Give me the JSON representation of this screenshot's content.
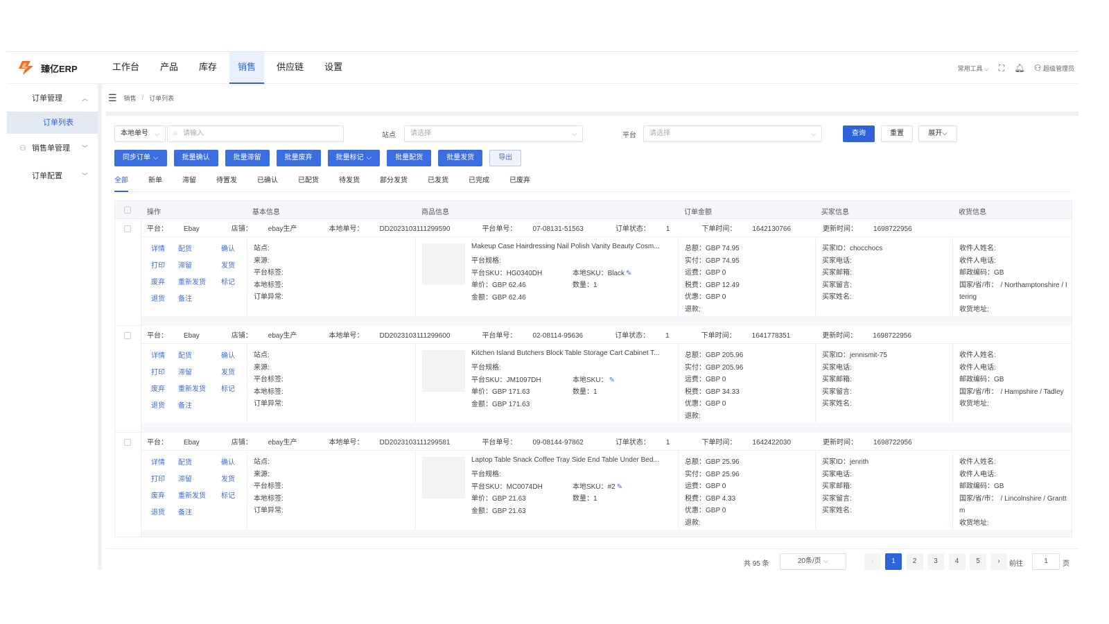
{
  "app": {
    "name": "臻亿ERP",
    "brand_color": "#f36c21",
    "accent": "#2f63d8"
  },
  "nav": [
    {
      "label": "工作台"
    },
    {
      "label": "产品"
    },
    {
      "label": "库存"
    },
    {
      "label": "销售",
      "active": true
    },
    {
      "label": "供应链"
    },
    {
      "label": "设置"
    }
  ],
  "header": {
    "tools": "常用工具",
    "user": "超级管理员"
  },
  "sidebar": {
    "groups": [
      {
        "label": "订单管理",
        "expanded": true,
        "children": [
          {
            "label": "订单列表",
            "active": true
          }
        ]
      },
      {
        "label": "销售单管理",
        "icon": "user-icon",
        "expanded": false
      },
      {
        "label": "订单配置",
        "expanded": false
      }
    ]
  },
  "breadcrumb": [
    "销售",
    "订单列表"
  ],
  "filter": {
    "type_select": "本地单号",
    "search_placeholder": "请输入",
    "site_label": "站点",
    "site_placeholder": "请选择",
    "platform_label": "平台",
    "platform_placeholder": "请选择",
    "query": "查询",
    "reset": "重置",
    "expand": "展开"
  },
  "toolbar": [
    {
      "label": "同步订单",
      "dropdown": true
    },
    {
      "label": "批量确认"
    },
    {
      "label": "批量滞留"
    },
    {
      "label": "批量废弃"
    },
    {
      "label": "批量标记",
      "dropdown": true
    },
    {
      "label": "批量配货"
    },
    {
      "label": "批量发货"
    },
    {
      "label": "导出",
      "plain": true
    }
  ],
  "tabs": [
    "全部",
    "新单",
    "滞留",
    "待置发",
    "已确认",
    "已配货",
    "待发货",
    "部分发货",
    "已发货",
    "已完成",
    "已废弃"
  ],
  "columns": [
    "操作",
    "基本信息",
    "商品信息",
    "订单金额",
    "买家信息",
    "收货信息"
  ],
  "actions": [
    "详情",
    "配货",
    "确认",
    "打印",
    "滞留",
    "发货",
    "废弃",
    "重新发货",
    "标记",
    "退货",
    "备注"
  ],
  "labels": {
    "platform": "平台：",
    "shop": "店铺：",
    "local_no": "本地单号：",
    "platform_no": "平台单号：",
    "status": "订单状态：",
    "order_time": "下单时间：",
    "update_time": "更新时间：",
    "basic": [
      "站点:",
      "来源:",
      "平台标签:",
      "本地标签:",
      "订单异常:"
    ],
    "spec": "平台规格:",
    "psku": "平台SKU：",
    "lsku": "本地SKU：",
    "unit_price": "单价：",
    "qty": "数量：",
    "amount": "金额：",
    "total": "总额：",
    "paid": "实付：",
    "shipping": "运费：",
    "tax": "税费：",
    "discount": "优惠：",
    "refund": "退款:",
    "buyer_id": "买家ID：",
    "buyer_phone": "买家电话:",
    "buyer_email": "买家邮箱:",
    "buyer_msg": "买家留言:",
    "buyer_name": "买家姓名:",
    "recv_name": "收件人姓名:",
    "recv_phone": "收件人电话:",
    "postcode": "邮政编码：",
    "region": "国家/省/市：",
    "address": "收货地址:"
  },
  "orders": [
    {
      "platform": "Ebay",
      "shop": "ebay生产",
      "local_no": "DD2023103111299590",
      "platform_no": "07-08131-51563",
      "status": "1",
      "order_time": "1642130766",
      "update_time": "1698722956",
      "title": "Makeup Case Hairdressing Nail Polish Vanity Beauty Cosm...",
      "psku": "HG0340DH",
      "lsku": "Black",
      "unit_price": "GBP 62.46",
      "qty": "1",
      "amount": "GBP 62.46",
      "total": "GBP 74.95",
      "paid": "GBP 74.95",
      "shipping": "GBP 0",
      "tax": "GBP 12.49",
      "discount": "GBP 0",
      "buyer_id": "chocchocs",
      "postcode": "GB",
      "region1": "/ Northamptonshire / I",
      "region2": "tering"
    },
    {
      "platform": "Ebay",
      "shop": "ebay生产",
      "local_no": "DD2023103111299600",
      "platform_no": "02-08114-95636",
      "status": "1",
      "order_time": "1641778351",
      "update_time": "1698722956",
      "title": "Kitchen Island Butchers Block Table Storage Cart Cabinet T...",
      "psku": "JM1097DH",
      "lsku": "",
      "unit_price": "GBP 171.63",
      "qty": "1",
      "amount": "GBP 171.63",
      "total": "GBP 205.96",
      "paid": "GBP 205.96",
      "shipping": "GBP 0",
      "tax": "GBP 34.33",
      "discount": "GBP 0",
      "buyer_id": "jennismit-75",
      "postcode": "GB",
      "region1": "/ Hampshire / Tadley",
      "region2": ""
    },
    {
      "platform": "Ebay",
      "shop": "ebay生产",
      "local_no": "DD2023103111299581",
      "platform_no": "09-08144-97862",
      "status": "1",
      "order_time": "1642422030",
      "update_time": "1698722956",
      "title": "Laptop Table Snack Coffee Tray Side End Table Under Bed...",
      "psku": "MC0074DH",
      "lsku": "#2",
      "unit_price": "GBP 21.63",
      "qty": "1",
      "amount": "GBP 21.63",
      "total": "GBP 25.96",
      "paid": "GBP 25.96",
      "shipping": "GBP 0",
      "tax": "GBP 4.33",
      "discount": "GBP 0",
      "buyer_id": "jenrith",
      "postcode": "GB",
      "region1": "/ Lincolnshire / Grantt",
      "region2": "m"
    }
  ],
  "pager": {
    "total": "共 95 条",
    "page_size": "20条/页",
    "pages": [
      "1",
      "2",
      "3",
      "4",
      "5"
    ],
    "current": "1",
    "goto_label": "前往",
    "goto_value": "1",
    "page_suffix": "页"
  }
}
